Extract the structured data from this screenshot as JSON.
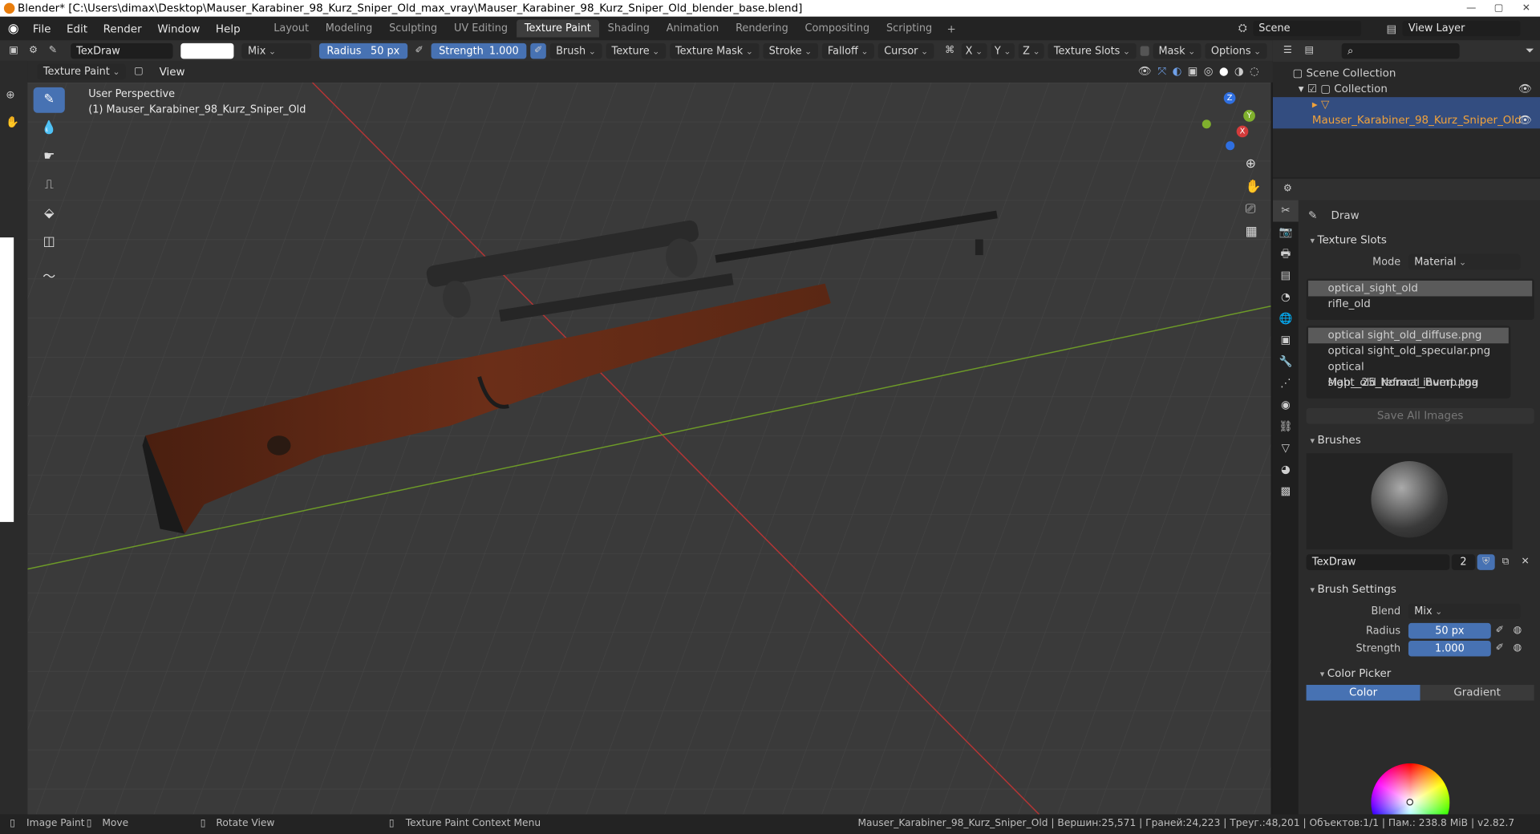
{
  "window_title": "Blender* [C:\\Users\\dimax\\Desktop\\Mauser_Karabiner_98_Kurz_Sniper_Old_max_vray\\Mauser_Karabiner_98_Kurz_Sniper_Old_blender_base.blend]",
  "menu": [
    "File",
    "Edit",
    "Render",
    "Window",
    "Help"
  ],
  "workspaces": [
    "Layout",
    "Modeling",
    "Sculpting",
    "UV Editing",
    "Texture Paint",
    "Shading",
    "Animation",
    "Rendering",
    "Compositing",
    "Scripting"
  ],
  "active_workspace": "Texture Paint",
  "scene_name": "Scene",
  "view_layer": "View Layer",
  "header": {
    "brush_name": "TexDraw",
    "blend": "Mix",
    "radius_label": "Radius",
    "radius_value": "50 px",
    "strength_label": "Strength",
    "strength_value": "1.000",
    "menus": [
      "Brush",
      "Texture",
      "Texture Mask",
      "Stroke",
      "Falloff",
      "Cursor"
    ],
    "axes": [
      "X",
      "Y",
      "Z"
    ],
    "texture_slots": "Texture Slots",
    "mask": "Mask",
    "options": "Options"
  },
  "header2": {
    "mode": "Texture Paint",
    "view": "View"
  },
  "viewport": {
    "perspective": "User Perspective",
    "object": "(1) Mauser_Karabiner_98_Kurz_Sniper_Old"
  },
  "outliner": {
    "scene_collection": "Scene Collection",
    "collection": "Collection",
    "object": "Mauser_Karabiner_98_Kurz_Sniper_Old"
  },
  "props": {
    "tool_name": "Draw",
    "texture_slots_title": "Texture Slots",
    "mode_label": "Mode",
    "mode_value": "Material",
    "materials": [
      "optical_sight_old",
      "rifle_old"
    ],
    "images": [
      "optical sight_old_diffuse.png",
      "optical sight_old_specular.png",
      "optical sight_old_refract_invert.png",
      "Map__25_Normal_Bump.tga"
    ],
    "save_all": "Save All Images",
    "brushes_title": "Brushes",
    "brush_name": "TexDraw",
    "brush_users": "2",
    "brush_settings_title": "Brush Settings",
    "blend_label": "Blend",
    "blend_value": "Mix",
    "radius_label": "Radius",
    "radius_value": "50 px",
    "strength_label": "Strength",
    "strength_value": "1.000",
    "color_picker_title": "Color Picker",
    "color_tab": "Color",
    "gradient_tab": "Gradient"
  },
  "status": {
    "left1": "Image Paint",
    "left2": "Move",
    "left3": "Rotate View",
    "left4": "Texture Paint Context Menu",
    "right": "Mauser_Karabiner_98_Kurz_Sniper_Old | Вершин:25,571 | Граней:24,223 | Треуг.:48,201 | Объектов:1/1 | Пам.: 238.8 MiB | v2.82.7"
  },
  "colors": {
    "accent": "#4772b3",
    "viewport_bg": "#3a3a3a",
    "x_axis": "#d43b3b",
    "y_axis": "#7fb02d",
    "z_axis": "#2f6fe0"
  }
}
